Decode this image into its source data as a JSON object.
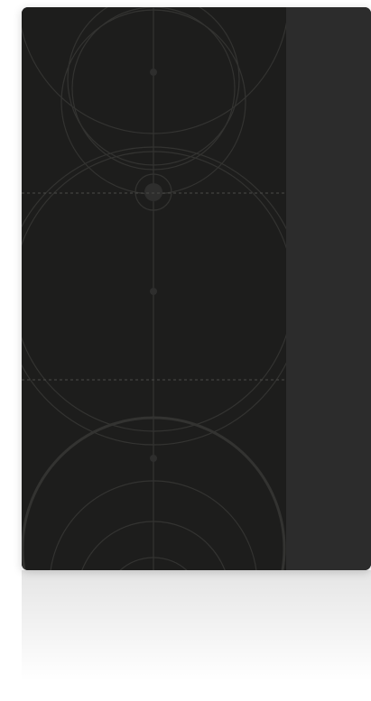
{
  "colors": {
    "page_background": "#ffffff",
    "left_panel": "#1d1d1c",
    "right_panel": "#2c2c2c",
    "pattern_stroke": "#333331",
    "dashed_divider": "#4a4a48"
  },
  "sections": [
    {
      "id": "top"
    },
    {
      "id": "middle"
    },
    {
      "id": "bottom"
    }
  ]
}
